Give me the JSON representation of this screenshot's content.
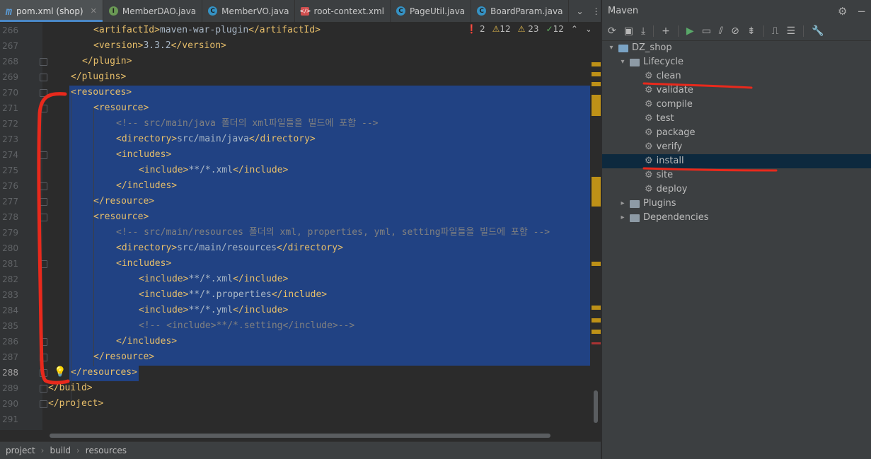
{
  "tabs": [
    {
      "label": "pom.xml (shop)",
      "icon": "maven-file-icon",
      "active": true
    },
    {
      "label": "MemberDAO.java",
      "icon": "interface-icon"
    },
    {
      "label": "MemberVO.java",
      "icon": "class-icon"
    },
    {
      "label": "root-context.xml",
      "icon": "xml-file-icon"
    },
    {
      "label": "PageUtil.java",
      "icon": "class-icon"
    },
    {
      "label": "BoardParam.java",
      "icon": "class-icon"
    }
  ],
  "inspections": {
    "errors": "2",
    "warnings": "12",
    "weak_warnings": "23",
    "typos": "12"
  },
  "line_numbers": [
    "266",
    "267",
    "268",
    "269",
    "270",
    "271",
    "272",
    "273",
    "274",
    "275",
    "276",
    "277",
    "278",
    "279",
    "280",
    "281",
    "282",
    "283",
    "284",
    "285",
    "286",
    "287",
    "288",
    "289",
    "290",
    "291"
  ],
  "code_lines": [
    {
      "indent": 2,
      "parts": [
        [
          "tag",
          "<artifactId>"
        ],
        [
          "tx",
          "maven-war-plugin"
        ],
        [
          "tag",
          "</artifactId>"
        ]
      ]
    },
    {
      "indent": 2,
      "parts": [
        [
          "tag",
          "<version>"
        ],
        [
          "tx",
          "3.3.2"
        ],
        [
          "tag",
          "</version>"
        ]
      ]
    },
    {
      "indent": 1.5,
      "parts": [
        [
          "tag",
          "</plugin>"
        ]
      ]
    },
    {
      "indent": 1,
      "parts": [
        [
          "tag",
          "</plugins>"
        ]
      ]
    },
    {
      "indent": 1,
      "parts": [
        [
          "tag",
          "<resources>"
        ]
      ]
    },
    {
      "indent": 2,
      "parts": [
        [
          "tag",
          "<resource>"
        ]
      ]
    },
    {
      "indent": 3,
      "parts": [
        [
          "cm",
          "<!-- src/main/java 폴더의 xml파일들을 빌드에 포함 -->"
        ]
      ]
    },
    {
      "indent": 3,
      "parts": [
        [
          "tag",
          "<directory>"
        ],
        [
          "tx",
          "src/main/java"
        ],
        [
          "tag",
          "</directory>"
        ]
      ]
    },
    {
      "indent": 3,
      "parts": [
        [
          "tag",
          "<includes>"
        ]
      ]
    },
    {
      "indent": 4,
      "parts": [
        [
          "tag",
          "<include>"
        ],
        [
          "tx",
          "**/*.xml"
        ],
        [
          "tag",
          "</include>"
        ]
      ]
    },
    {
      "indent": 3,
      "parts": [
        [
          "tag",
          "</includes>"
        ]
      ]
    },
    {
      "indent": 2,
      "parts": [
        [
          "tag",
          "</resource>"
        ]
      ]
    },
    {
      "indent": 2,
      "parts": [
        [
          "tag",
          "<resource>"
        ]
      ]
    },
    {
      "indent": 3,
      "parts": [
        [
          "cm",
          "<!-- src/main/resources 폴더의 xml, properties, yml, setting파일들을 빌드에 포함 -->"
        ]
      ]
    },
    {
      "indent": 3,
      "parts": [
        [
          "tag",
          "<directory>"
        ],
        [
          "tx",
          "src/main/resources"
        ],
        [
          "tag",
          "</directory>"
        ]
      ]
    },
    {
      "indent": 3,
      "parts": [
        [
          "tag",
          "<includes>"
        ]
      ]
    },
    {
      "indent": 4,
      "parts": [
        [
          "tag",
          "<include>"
        ],
        [
          "tx",
          "**/*.xml"
        ],
        [
          "tag",
          "</include>"
        ]
      ]
    },
    {
      "indent": 4,
      "parts": [
        [
          "tag",
          "<include>"
        ],
        [
          "tx",
          "**/*.properties"
        ],
        [
          "tag",
          "</include>"
        ]
      ]
    },
    {
      "indent": 4,
      "parts": [
        [
          "tag",
          "<include>"
        ],
        [
          "tx",
          "**/*.yml"
        ],
        [
          "tag",
          "</include>"
        ]
      ]
    },
    {
      "indent": 4,
      "parts": [
        [
          "cm",
          "<!-- <include>**/*.setting</include>-->"
        ]
      ]
    },
    {
      "indent": 3,
      "parts": [
        [
          "tag",
          "</includes>"
        ]
      ]
    },
    {
      "indent": 2,
      "parts": [
        [
          "tag",
          "</resource>"
        ]
      ]
    },
    {
      "indent": 1,
      "parts": [
        [
          "tag",
          "</resources>"
        ]
      ]
    },
    {
      "indent": 0,
      "parts": [
        [
          "tag",
          "</build>"
        ]
      ]
    },
    {
      "indent": 0,
      "parts": [
        [
          "tag",
          "</project>"
        ]
      ]
    },
    {
      "indent": 0,
      "parts": []
    }
  ],
  "breadcrumbs": [
    "project",
    "build",
    "resources"
  ],
  "maven": {
    "title": "Maven",
    "project": "DZ_shop",
    "lifecycle_label": "Lifecycle",
    "goals": [
      "clean",
      "validate",
      "compile",
      "test",
      "package",
      "verify",
      "install",
      "site",
      "deploy"
    ],
    "selected_goal": "install",
    "plugins_label": "Plugins",
    "dependencies_label": "Dependencies"
  },
  "colors": {
    "selection": "#214283",
    "tag": "#e8bf6a",
    "comment": "#808080",
    "annotation": "#e8291c"
  }
}
